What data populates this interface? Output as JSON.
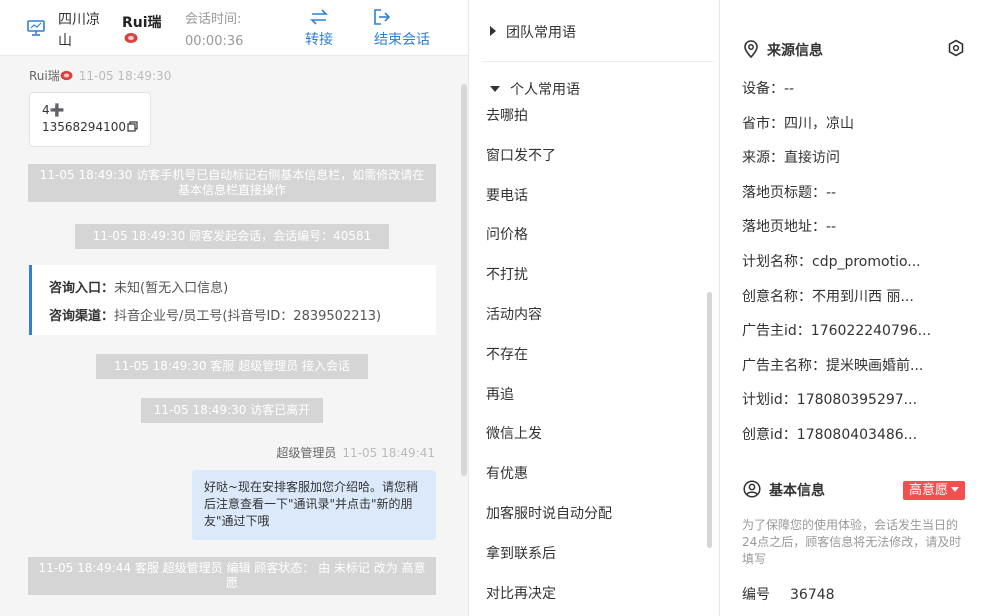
{
  "header": {
    "visitor_location": "四川凉山",
    "agent_name": "Rui瑞",
    "session_label": "会话时间:",
    "session_time": "00:00:36",
    "transfer_label": "转接",
    "end_label": "结束会话"
  },
  "chat": {
    "sender1_name": "Rui瑞",
    "sender1_time": "11-05 18:49:30",
    "bubble1_line1": "4➕",
    "bubble1_line2": "13568294100",
    "sys1": "11-05 18:49:30 访客手机号已自动标记右侧基本信息栏，如需修改请在基本信息栏直接操作",
    "sys2": "11-05 18:49:30 顾客发起会话，会话编号：40581",
    "info_card": {
      "entry_label": "咨询入口：",
      "entry_value": "未知(暂无入口信息)",
      "channel_label": "咨询渠道：",
      "channel_value": "抖音企业号/员工号(抖音号ID：2839502213)"
    },
    "sys3": "11-05 18:49:30 客服 超级管理员 接入会话",
    "sys4": "11-05 18:49:30 访客已离开",
    "sender2_name": "超级管理员",
    "sender2_time": "11-05 18:49:41",
    "bubble2": "好哒~现在安排客服加您介绍哈。请您稍后注意查看一下\"通讯录\"并点击\"新的朋友\"通过下哦",
    "sys5": "11-05 18:49:44 客服 超级管理员 编辑 顾客状态： 由 未标记 改为 高意愿"
  },
  "phrases": {
    "team_group": "团队常用语",
    "personal_group": "个人常用语",
    "items": [
      "去哪拍",
      "窗口发不了",
      "要电话",
      "问价格",
      "不打扰",
      "活动内容",
      "不存在",
      "再追",
      "微信上发",
      "有优惠",
      "加客服时说自动分配",
      "拿到联系后",
      "对比再决定"
    ]
  },
  "source_info": {
    "title": "来源信息",
    "rows": [
      {
        "label": "设备：",
        "value": "--"
      },
      {
        "label": "省市：",
        "value": "四川，凉山"
      },
      {
        "label": "来源：",
        "value": "直接访问"
      },
      {
        "label": "落地页标题：",
        "value": "--"
      },
      {
        "label": "落地页地址：",
        "value": "--"
      },
      {
        "label": "计划名称：",
        "value": "cdp_promotio..."
      },
      {
        "label": "创意名称：",
        "value": "不用到川西 丽..."
      },
      {
        "label": "广告主id：",
        "value": "176022240796..."
      },
      {
        "label": "广告主名称：",
        "value": "提米映画婚前..."
      },
      {
        "label": "计划id：",
        "value": "178080395297..."
      },
      {
        "label": "创意id：",
        "value": "178080403486..."
      }
    ]
  },
  "basic_info": {
    "title": "基本信息",
    "intent_badge": "高意愿",
    "notice": "为了保障您的使用体验，会话发生当日的24点之后，顾客信息将无法修改，请及时填写",
    "id_label": "编号",
    "id_value": "36748"
  },
  "colors": {
    "accent": "#2f7fd8",
    "badge_red": "#f44f4f",
    "agent_bubble": "#dbe9fb",
    "system_msg": "#d5d5d5"
  },
  "icons": {
    "header": "monitor-icon",
    "transfer": "transfer-icon",
    "end": "exit-icon",
    "source": "location-pin-icon",
    "settings": "hexagon-settings-icon",
    "basic": "user-circle-icon",
    "copy": "copy-icon"
  }
}
